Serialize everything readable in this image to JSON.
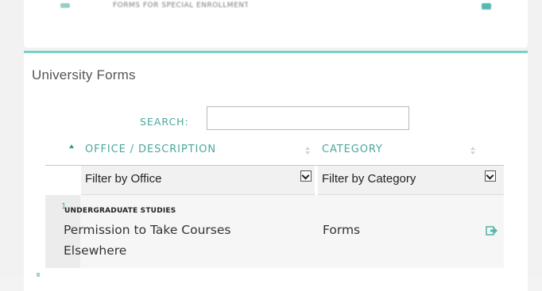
{
  "top_card": {
    "blurred_text": "FORMS FOR SPECIAL ENROLLMENT",
    "icon_left": "document-icon",
    "icon_right": "external-link-icon"
  },
  "card": {
    "title": "University Forms"
  },
  "search": {
    "label": "SEARCH:",
    "value": "",
    "placeholder": ""
  },
  "table": {
    "columns": [
      {
        "label": "OFFICE / DESCRIPTION",
        "sort": "ascending"
      },
      {
        "label": "CATEGORY",
        "sort": "none"
      }
    ],
    "filters": {
      "office": "Filter by Office",
      "category": "Filter by Category"
    },
    "rows": [
      {
        "index": "1",
        "office": "UNDERGRADUATE STUDIES",
        "title": "Permission to Take Courses Elsewhere",
        "category": "Forms",
        "action_icon": "external-link-icon"
      }
    ]
  },
  "colors": {
    "accent": "#4ba79d",
    "accent_border": "#7ccfc4",
    "text": "#333333",
    "page_bg": "#f2f2f2"
  }
}
